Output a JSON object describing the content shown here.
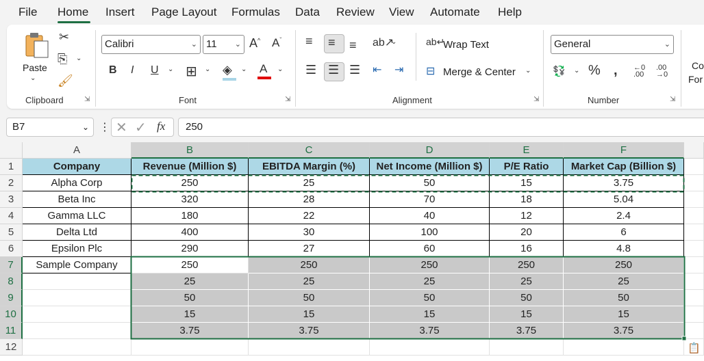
{
  "menu": [
    "File",
    "Home",
    "Insert",
    "Page Layout",
    "Formulas",
    "Data",
    "Review",
    "View",
    "Automate",
    "Help"
  ],
  "ribbon": {
    "clipboard": {
      "paste_label": "Paste",
      "group_label": "Clipboard"
    },
    "font": {
      "font_name": "Calibri",
      "font_size": "11",
      "group_label": "Font"
    },
    "alignment": {
      "wrap_text": "Wrap Text",
      "merge_center": "Merge & Center",
      "group_label": "Alignment"
    },
    "number": {
      "format": "General",
      "group_label": "Number"
    },
    "cut_off": {
      "line1": "Co",
      "line2": "For"
    }
  },
  "formula_bar": {
    "name_box": "B7",
    "formula": "250"
  },
  "columns": [
    "A",
    "B",
    "C",
    "D",
    "E",
    "F"
  ],
  "rows": [
    "1",
    "2",
    "3",
    "4",
    "5",
    "6",
    "7",
    "8",
    "9",
    "10",
    "11",
    "12"
  ],
  "headers": [
    "Company",
    "Revenue (Million $)",
    "EBITDA Margin (%)",
    "Net Income (Million $)",
    "P/E Ratio",
    "Market Cap (Billion $)"
  ],
  "data": [
    [
      "Alpha Corp",
      "250",
      "25",
      "50",
      "15",
      "3.75"
    ],
    [
      "Beta Inc",
      "320",
      "28",
      "70",
      "18",
      "5.04"
    ],
    [
      "Gamma LLC",
      "180",
      "22",
      "40",
      "12",
      "2.4"
    ],
    [
      "Delta Ltd",
      "400",
      "30",
      "100",
      "20",
      "6"
    ],
    [
      "Epsilon Plc",
      "290",
      "27",
      "60",
      "16",
      "4.8"
    ],
    [
      "Sample Company",
      "250",
      "250",
      "250",
      "250",
      "250"
    ],
    [
      "",
      "25",
      "25",
      "25",
      "25",
      "25"
    ],
    [
      "",
      "50",
      "50",
      "50",
      "50",
      "50"
    ],
    [
      "",
      "15",
      "15",
      "15",
      "15",
      "15"
    ],
    [
      "",
      "3.75",
      "3.75",
      "3.75",
      "3.75",
      "3.75"
    ]
  ],
  "colors": {
    "header_fill": "#add8e6",
    "selection_fill": "#c9c9c9",
    "accent": "#1e6f43"
  }
}
